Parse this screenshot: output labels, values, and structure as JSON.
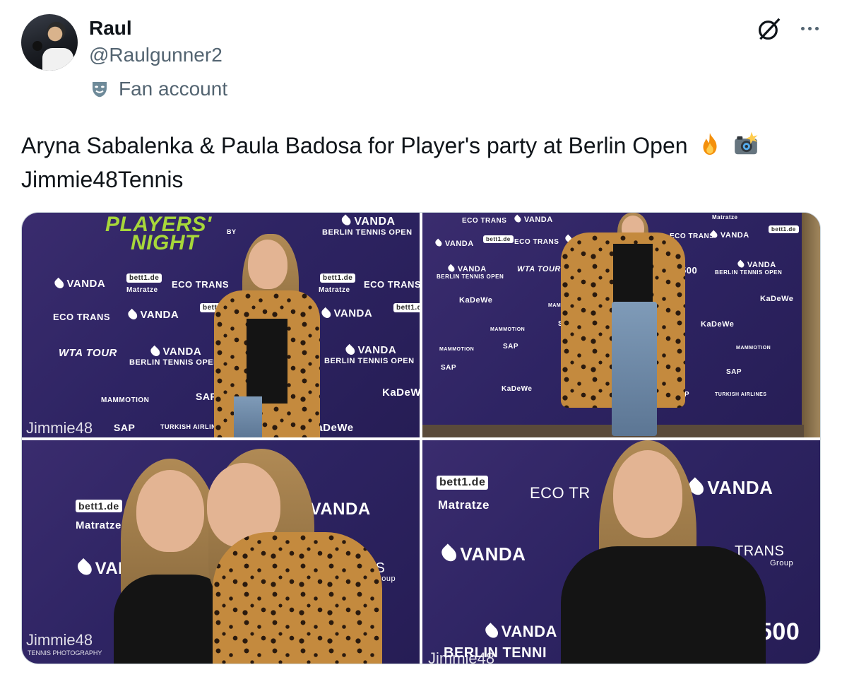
{
  "author": {
    "display_name": "Raul",
    "handle": "@Raulgunner2",
    "label": "Fan account"
  },
  "tweet": {
    "text_line1": "Aryna Sabalenka &  Paula Badosa for Player's party at Berlin Open",
    "text_line2": "Jimmie48Tennis",
    "emojis": [
      "fire-emoji",
      "camera-flash-emoji"
    ]
  },
  "photos": {
    "p1": {
      "headline1": "PLAYERS'",
      "headline2": "NIGHT",
      "by": "BY",
      "logos": [
        "VANDA",
        "BERLIN TENNIS OPEN",
        "bett1.de",
        "Matratze",
        "ECO TRANS",
        "WTA TOUR",
        "SAP",
        "KaDeWe",
        "MAMMOTION",
        "TURKISH AIRLINES"
      ],
      "watermark": "Jimmie48"
    },
    "p2": {
      "logos": [
        "ECO TRANS",
        "VANDA",
        "Matratze",
        "bett1.de",
        "WTA TOUR",
        "BERLIN TENNIS OPEN",
        "KaDeWe",
        "MAMMOTION",
        "SAP",
        "500",
        "TURKISH AIRLINES"
      ]
    },
    "p3": {
      "logos": [
        "bett1.de",
        "Matratze",
        "VANDA",
        "TRANS",
        "Group"
      ],
      "watermark": "Jimmie48",
      "watermark_sub": "TENNIS PHOTOGRAPHY"
    },
    "p4": {
      "logos": [
        "bett1.de",
        "Matratze",
        "ECO TR",
        "VANDA",
        "TRANS",
        "Group",
        "500",
        "BERLIN TENNI"
      ],
      "watermark": "Jimmie48"
    }
  },
  "colors": {
    "text_primary": "#0f1419",
    "text_secondary": "#536471",
    "border": "#cfd9de",
    "backdrop_purple": "#2e2463",
    "accent_green": "#a7d73a"
  }
}
